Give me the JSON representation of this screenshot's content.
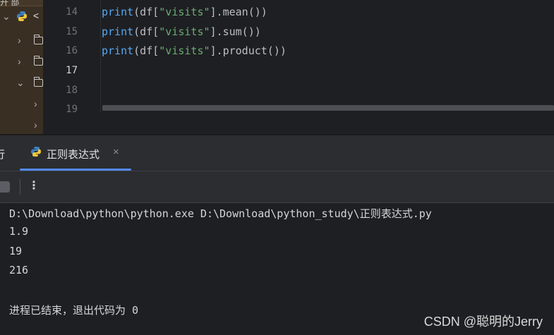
{
  "tree": {
    "header_fragment": "开 部",
    "project_label_fragment": "<"
  },
  "editor": {
    "line_numbers": [
      "14",
      "15",
      "16",
      "17",
      "18",
      "19"
    ],
    "active_line": "17",
    "code_lines": [
      {
        "fn": "print",
        "pre": "(df[",
        "str": "\"visits\"",
        "post": "].mean())"
      },
      {
        "fn": "print",
        "pre": "(df[",
        "str": "\"visits\"",
        "post": "].sum())"
      },
      {
        "fn": "print",
        "pre": "(df[",
        "str": "\"visits\"",
        "post": "].product())"
      }
    ]
  },
  "run_panel": {
    "partial_tab_label": "行",
    "tab_label": "正则表达式",
    "close_glyph": "×",
    "more_glyph": "⋮"
  },
  "console": {
    "command": "D:\\Download\\python\\python.exe D:\\Download\\python_study\\正则表达式.py",
    "outputs": [
      "1.9",
      "19",
      "216"
    ],
    "exit_message": "进程已结束，退出代码为 0"
  },
  "watermark": "CSDN @聪明的Jerry",
  "colors": {
    "background": "#1e1f22",
    "function": "#56a8f5",
    "string": "#6aab73",
    "tab_underline": "#548af7",
    "tree_background": "#3a2f23"
  },
  "icons": [
    "python-icon",
    "folder-icon",
    "chevron-right-icon",
    "chevron-down-icon",
    "close-icon",
    "stop-icon",
    "more-options-icon"
  ]
}
